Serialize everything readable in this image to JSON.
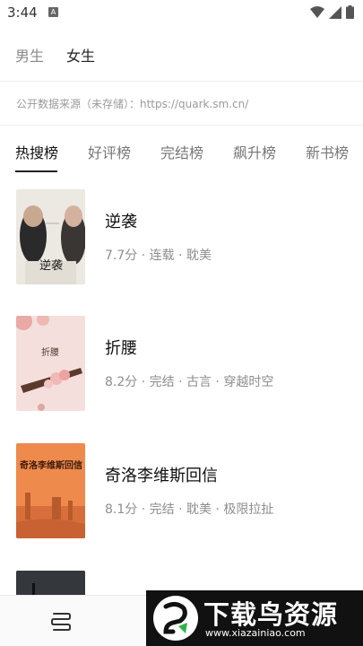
{
  "status_bar": {
    "time": "3:44",
    "notification_glyph": "A"
  },
  "gender_tabs": [
    {
      "label": "男生",
      "active": false
    },
    {
      "label": "女生",
      "active": true
    }
  ],
  "source_note": "公开数据来源（未存储）：https://quark.sm.cn/",
  "rank_tabs": [
    {
      "label": "热搜榜",
      "active": true
    },
    {
      "label": "好评榜",
      "active": false
    },
    {
      "label": "完结榜",
      "active": false
    },
    {
      "label": "飙升榜",
      "active": false
    },
    {
      "label": "新书榜",
      "active": false
    }
  ],
  "books": [
    {
      "title": "逆袭",
      "meta": "7.7分 · 连载 · 耽美",
      "cover_text": "逆袭"
    },
    {
      "title": "折腰",
      "meta": "8.2分 · 完结 · 古言 · 穿越时空",
      "cover_text": "折腰"
    },
    {
      "title": "奇洛李维斯回信",
      "meta": "8.1分 · 完结 · 耽美 · 极限拉扯",
      "cover_text": "奇洛李维斯回信"
    },
    {
      "title": "",
      "meta": "",
      "cover_text": ""
    }
  ],
  "watermark": {
    "text": "下载鸟资源",
    "url": "www.xiazainiao.com"
  },
  "colors": {
    "active_tab": "#222222",
    "inactive_tab": "#777777",
    "meta": "#8e8e8e",
    "background": "#ffffff"
  }
}
